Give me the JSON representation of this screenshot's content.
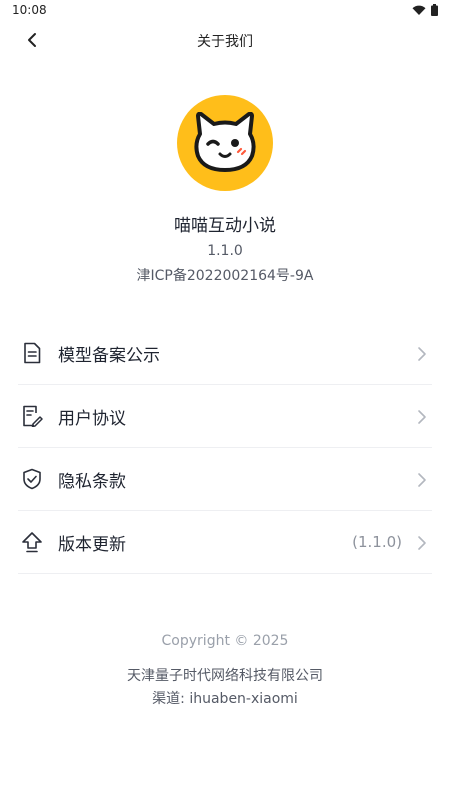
{
  "status_bar": {
    "time": "10:08",
    "icons": [
      "wifi-icon",
      "battery-icon"
    ]
  },
  "header": {
    "title": "关于我们",
    "back_icon": "chevron-left-icon"
  },
  "app": {
    "name": "喵喵互动小说",
    "version": "1.1.0",
    "icp": "津ICP备2022002164号-9A",
    "logo_icon": "cat-face-logo",
    "brand_color": "#ffbe1a"
  },
  "menu": {
    "items": [
      {
        "label": "模型备案公示",
        "icon": "document-icon",
        "value": ""
      },
      {
        "label": "用户协议",
        "icon": "agreement-pen-icon",
        "value": ""
      },
      {
        "label": "隐私条款",
        "icon": "shield-check-icon",
        "value": ""
      },
      {
        "label": "版本更新",
        "icon": "upload-arrow-icon",
        "value": "(1.1.0)"
      }
    ]
  },
  "footer": {
    "copyright": "Copyright © 2025",
    "company": "天津量子时代网络科技有限公司",
    "channel": "渠道: ihuaben-xiaomi"
  }
}
